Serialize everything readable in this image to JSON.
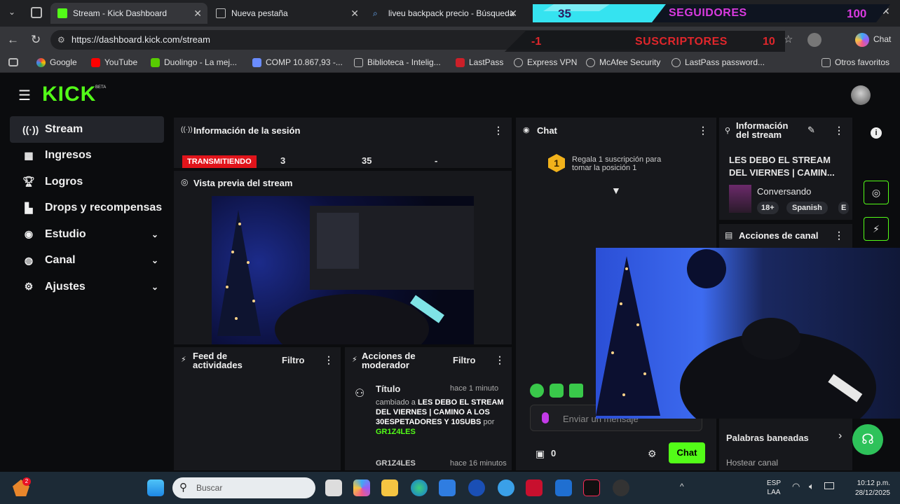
{
  "browser": {
    "tabs": [
      {
        "title": "Stream - Kick Dashboard",
        "active": true
      },
      {
        "title": "Nueva pestaña",
        "active": false
      },
      {
        "title": "liveu backpack precio - Búsqueda",
        "active": false
      }
    ],
    "url": "https://dashboard.kick.com/stream",
    "chat_label": "Chat",
    "bookmarks": [
      "Google",
      "YouTube",
      "Duolingo - La mej...",
      "COMP 10.867,93 -...",
      "Biblioteca - Intelig...",
      "LastPass",
      "Express VPN",
      "McAfee Security",
      "LastPass password..."
    ],
    "other_favorites": "Otros favoritos"
  },
  "overlay": {
    "followers_count": "35",
    "followers_label": "SEGUIDORES",
    "followers_goal": "100",
    "subs_count": "-1",
    "subs_label": "SUSCRIPTORES",
    "subs_goal": "10"
  },
  "kick": {
    "logo": "KICK",
    "beta": "BETA",
    "sidebar": [
      {
        "label": "Stream",
        "icon": "broadcast-icon",
        "active": true
      },
      {
        "label": "Ingresos",
        "icon": "calculator-icon"
      },
      {
        "label": "Logros",
        "icon": "trophy-icon"
      },
      {
        "label": "Drops y recompensas",
        "icon": "drops-icon"
      },
      {
        "label": "Estudio",
        "icon": "studio-icon",
        "chevron": true
      },
      {
        "label": "Canal",
        "icon": "user-icon",
        "chevron": true
      },
      {
        "label": "Ajustes",
        "icon": "gear-icon",
        "chevron": true
      }
    ],
    "session": {
      "title": "Información de la sesión",
      "status": "TRANSMITIENDO",
      "stat1": "3",
      "stat2": "35",
      "stat3": "-"
    },
    "preview": {
      "title": "Vista previa del stream"
    },
    "feed": {
      "title": "Feed de actividades",
      "filter": "Filtro"
    },
    "mod_actions": {
      "title": "Acciones de moderador",
      "filter": "Filtro",
      "entry": {
        "type": "Título",
        "time": "hace 1 minuto",
        "prefix": "cambiado a",
        "value": "LES DEBO EL STREAM DEL VIERNES | CAMINO A LOS 30ESPETADORES Y 10SUBS",
        "by": "por",
        "user": "GR1Z4LES"
      },
      "entry2_user": "GR1Z4LES",
      "entry2_time": "hace 16 minutos"
    },
    "chat": {
      "title": "Chat",
      "gift_rank": "1",
      "gift_text": "Regala 1 suscripción para tomar la posición 1",
      "input_placeholder": "Enviar un mensaje",
      "count": "0",
      "send": "Chat"
    },
    "stream_info": {
      "title": "Información del stream",
      "stream_title": "LES DEBO EL STREAM DEL VIERNES | CAMIN...",
      "category": "Conversando",
      "tags": [
        "18+",
        "Spanish",
        "E"
      ]
    },
    "channel_actions": {
      "title": "Acciones de canal"
    },
    "banned_words": "Palabras baneadas",
    "host_channel": "Hostear canal"
  },
  "taskbar": {
    "search_placeholder": "Buscar",
    "lang1": "ESP",
    "lang2": "LAA",
    "time": "10:12 p.m.",
    "date": "28/12/2025",
    "notif_badge": "2"
  }
}
